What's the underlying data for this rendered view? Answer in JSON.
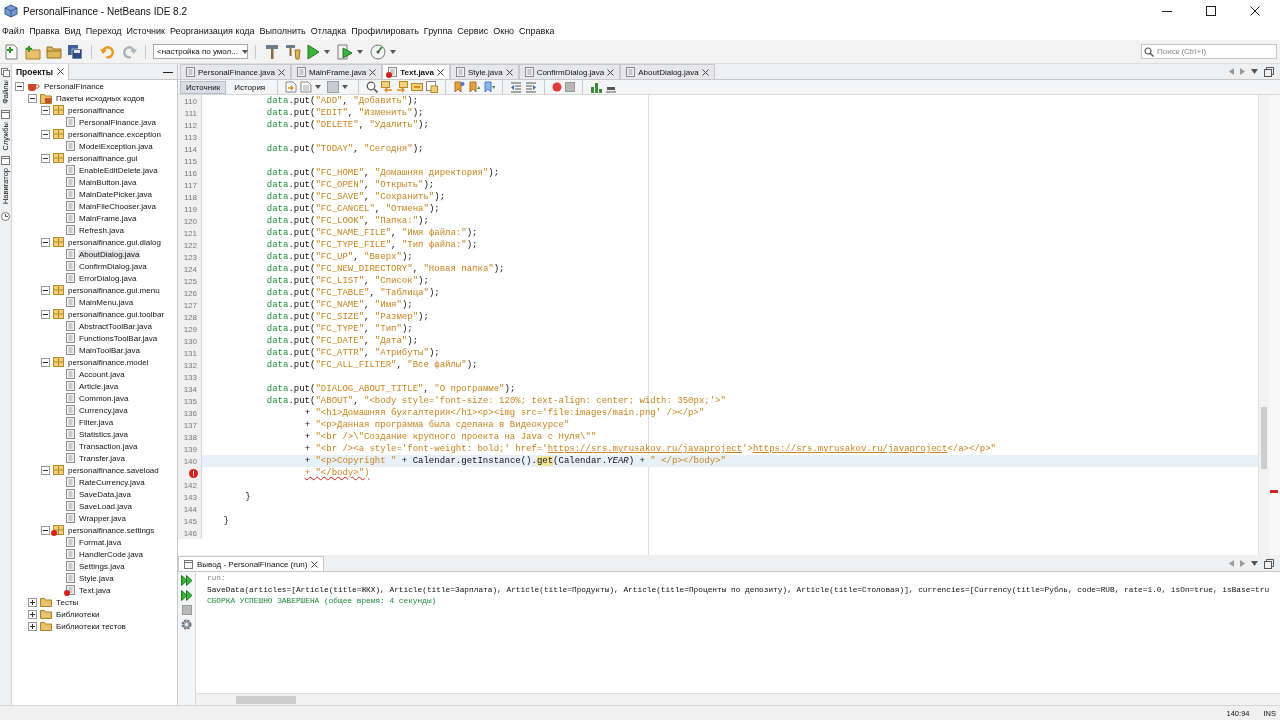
{
  "window": {
    "title": "PersonalFinance - NetBeans IDE 8.2"
  },
  "menu": [
    "Файл",
    "Правка",
    "Вид",
    "Переход",
    "Источник",
    "Реорганизация кода",
    "Выполнить",
    "Отладка",
    "Профилировать",
    "Группа",
    "Сервис",
    "Окно",
    "Справка"
  ],
  "toolbar": {
    "configuration": "<настройка по умол..."
  },
  "search": {
    "placeholder": "Поиск (Ctrl+I)"
  },
  "side_panels": [
    {
      "label": "Файлы"
    },
    {
      "label": "Службы"
    },
    {
      "label": "Навигатор"
    }
  ],
  "projects": {
    "title": "Проекты",
    "tree": [
      {
        "label": "PersonalFinance",
        "kind": "project",
        "expanded": true,
        "selected": false,
        "error": false,
        "children": [
          {
            "label": "Пакеты исходных кодов",
            "kind": "sources",
            "expanded": true,
            "selected": false,
            "error": false,
            "children": [
              {
                "label": "personalfinance",
                "kind": "package",
                "expanded": true,
                "selected": false,
                "error": false,
                "children": [
                  {
                    "label": "PersonalFinance.java",
                    "kind": "file",
                    "selected": false,
                    "error": false
                  }
                ]
              },
              {
                "label": "personalfinance.exception",
                "kind": "package",
                "expanded": true,
                "selected": false,
                "error": false,
                "children": [
                  {
                    "label": "ModelException.java",
                    "kind": "file",
                    "selected": false,
                    "error": false
                  }
                ]
              },
              {
                "label": "personalfinance.gui",
                "kind": "package",
                "expanded": true,
                "selected": false,
                "error": false,
                "children": [
                  {
                    "label": "EnableEditDelete.java",
                    "kind": "file",
                    "selected": false,
                    "error": false
                  },
                  {
                    "label": "MainButton.java",
                    "kind": "file",
                    "selected": false,
                    "error": false
                  },
                  {
                    "label": "MainDatePicker.java",
                    "kind": "file",
                    "selected": false,
                    "error": false
                  },
                  {
                    "label": "MainFileChooser.java",
                    "kind": "file",
                    "selected": false,
                    "error": false
                  },
                  {
                    "label": "MainFrame.java",
                    "kind": "file",
                    "selected": false,
                    "error": false
                  },
                  {
                    "label": "Refresh.java",
                    "kind": "file",
                    "selected": false,
                    "error": false
                  }
                ]
              },
              {
                "label": "personalfinance.gui.dialog",
                "kind": "package",
                "expanded": true,
                "selected": false,
                "error": false,
                "children": [
                  {
                    "label": "AboutDialog.java",
                    "kind": "file",
                    "selected": true,
                    "error": false
                  },
                  {
                    "label": "ConfirmDialog.java",
                    "kind": "file",
                    "selected": false,
                    "error": false
                  },
                  {
                    "label": "ErrorDialog.java",
                    "kind": "file",
                    "selected": false,
                    "error": false
                  }
                ]
              },
              {
                "label": "personalfinance.gui.menu",
                "kind": "package",
                "expanded": true,
                "selected": false,
                "error": false,
                "children": [
                  {
                    "label": "MainMenu.java",
                    "kind": "file",
                    "selected": false,
                    "error": false
                  }
                ]
              },
              {
                "label": "personalfinance.gui.toolbar",
                "kind": "package",
                "expanded": true,
                "selected": false,
                "error": false,
                "children": [
                  {
                    "label": "AbstractToolBar.java",
                    "kind": "file",
                    "selected": false,
                    "error": false
                  },
                  {
                    "label": "FunctionsToolBar.java",
                    "kind": "file",
                    "selected": false,
                    "error": false
                  },
                  {
                    "label": "MainToolBar.java",
                    "kind": "file",
                    "selected": false,
                    "error": false
                  }
                ]
              },
              {
                "label": "personalfinance.model",
                "kind": "package",
                "expanded": true,
                "selected": false,
                "error": false,
                "children": [
                  {
                    "label": "Account.java",
                    "kind": "file",
                    "selected": false,
                    "error": false
                  },
                  {
                    "label": "Article.java",
                    "kind": "file",
                    "selected": false,
                    "error": false
                  },
                  {
                    "label": "Common.java",
                    "kind": "file",
                    "selected": false,
                    "error": false
                  },
                  {
                    "label": "Currency.java",
                    "kind": "file",
                    "selected": false,
                    "error": false
                  },
                  {
                    "label": "Filter.java",
                    "kind": "file",
                    "selected": false,
                    "error": false
                  },
                  {
                    "label": "Statistics.java",
                    "kind": "file",
                    "selected": false,
                    "error": false
                  },
                  {
                    "label": "Transaction.java",
                    "kind": "file",
                    "selected": false,
                    "error": false
                  },
                  {
                    "label": "Transfer.java",
                    "kind": "file",
                    "selected": false,
                    "error": false
                  }
                ]
              },
              {
                "label": "personalfinance.saveload",
                "kind": "package",
                "expanded": true,
                "selected": false,
                "error": false,
                "children": [
                  {
                    "label": "RateCurrency.java",
                    "kind": "file",
                    "selected": false,
                    "error": false
                  },
                  {
                    "label": "SaveData.java",
                    "kind": "file",
                    "selected": false,
                    "error": false
                  },
                  {
                    "label": "SaveLoad.java",
                    "kind": "file",
                    "selected": false,
                    "error": false
                  },
                  {
                    "label": "Wrapper.java",
                    "kind": "file",
                    "selected": false,
                    "error": false
                  }
                ]
              },
              {
                "label": "personalfinance.settings",
                "kind": "package",
                "expanded": true,
                "selected": false,
                "error": true,
                "children": [
                  {
                    "label": "Format.java",
                    "kind": "file",
                    "selected": false,
                    "error": false
                  },
                  {
                    "label": "HandlerCode.java",
                    "kind": "file",
                    "selected": false,
                    "error": false
                  },
                  {
                    "label": "Settings.java",
                    "kind": "file",
                    "selected": false,
                    "error": false
                  },
                  {
                    "label": "Style.java",
                    "kind": "file",
                    "selected": false,
                    "error": false
                  },
                  {
                    "label": "Text.java",
                    "kind": "file",
                    "selected": false,
                    "error": true
                  }
                ]
              }
            ]
          },
          {
            "label": "Тесты",
            "kind": "folder",
            "expanded": false,
            "selected": false,
            "error": false
          },
          {
            "label": "Библиотеки",
            "kind": "folder",
            "expanded": false,
            "selected": false,
            "error": false
          },
          {
            "label": "Библиотеки тестов",
            "kind": "folder",
            "expanded": false,
            "selected": false,
            "error": false
          }
        ]
      }
    ]
  },
  "editor": {
    "tabs": [
      {
        "label": "PersonalFinance.java",
        "selected": false,
        "error": false
      },
      {
        "label": "MainFrame.java",
        "selected": false,
        "error": false
      },
      {
        "label": "Text.java",
        "selected": true,
        "error": true
      },
      {
        "label": "Style.java",
        "selected": false,
        "error": false
      },
      {
        "label": "ConfirmDialog.java",
        "selected": false,
        "error": false
      },
      {
        "label": "AboutDialog.java",
        "selected": false,
        "error": false
      }
    ],
    "views": [
      {
        "label": "Источник",
        "selected": true
      },
      {
        "label": "История",
        "selected": false
      }
    ],
    "lines": [
      {
        "number": "110",
        "current": false,
        "error": false,
        "segments": [
          {
            "kind": "field",
            "text": "            data"
          },
          {
            "kind": "plain",
            "text": ".put("
          },
          {
            "kind": "string",
            "text": "\"ADD\""
          },
          {
            "kind": "plain",
            "text": ", "
          },
          {
            "kind": "string",
            "text": "\"Добавить\""
          },
          {
            "kind": "plain",
            "text": ");"
          }
        ]
      },
      {
        "number": "111",
        "current": false,
        "error": false,
        "segments": [
          {
            "kind": "field",
            "text": "            data"
          },
          {
            "kind": "plain",
            "text": ".put("
          },
          {
            "kind": "string",
            "text": "\"EDIT\""
          },
          {
            "kind": "plain",
            "text": ", "
          },
          {
            "kind": "string",
            "text": "\"Изменить\""
          },
          {
            "kind": "plain",
            "text": ");"
          }
        ]
      },
      {
        "number": "112",
        "current": false,
        "error": false,
        "segments": [
          {
            "kind": "field",
            "text": "            data"
          },
          {
            "kind": "plain",
            "text": ".put("
          },
          {
            "kind": "string",
            "text": "\"DELETE\""
          },
          {
            "kind": "plain",
            "text": ", "
          },
          {
            "kind": "string",
            "text": "\"Удалить\""
          },
          {
            "kind": "plain",
            "text": ");"
          }
        ]
      },
      {
        "number": "113",
        "current": false,
        "error": false
      },
      {
        "number": "114",
        "current": false,
        "error": false,
        "segments": [
          {
            "kind": "field",
            "text": "            data"
          },
          {
            "kind": "plain",
            "text": ".put("
          },
          {
            "kind": "string",
            "text": "\"TODAY\""
          },
          {
            "kind": "plain",
            "text": ", "
          },
          {
            "kind": "string",
            "text": "\"Сегодня\""
          },
          {
            "kind": "plain",
            "text": ");"
          }
        ]
      },
      {
        "number": "115",
        "current": false,
        "error": false
      },
      {
        "number": "116",
        "current": false,
        "error": false,
        "segments": [
          {
            "kind": "field",
            "text": "            data"
          },
          {
            "kind": "plain",
            "text": ".put("
          },
          {
            "kind": "string",
            "text": "\"FC_HOME\""
          },
          {
            "kind": "plain",
            "text": ", "
          },
          {
            "kind": "string",
            "text": "\"Домашняя директория\""
          },
          {
            "kind": "plain",
            "text": ");"
          }
        ]
      },
      {
        "number": "117",
        "current": false,
        "error": false,
        "segments": [
          {
            "kind": "field",
            "text": "            data"
          },
          {
            "kind": "plain",
            "text": ".put("
          },
          {
            "kind": "string",
            "text": "\"FC_OPEN\""
          },
          {
            "kind": "plain",
            "text": ", "
          },
          {
            "kind": "string",
            "text": "\"Открыть\""
          },
          {
            "kind": "plain",
            "text": ");"
          }
        ]
      },
      {
        "number": "118",
        "current": false,
        "error": false,
        "segments": [
          {
            "kind": "field",
            "text": "            data"
          },
          {
            "kind": "plain",
            "text": ".put("
          },
          {
            "kind": "string",
            "text": "\"FC_SAVE\""
          },
          {
            "kind": "plain",
            "text": ", "
          },
          {
            "kind": "string",
            "text": "\"Сохранить\""
          },
          {
            "kind": "plain",
            "text": ");"
          }
        ]
      },
      {
        "number": "119",
        "current": false,
        "error": false,
        "segments": [
          {
            "kind": "field",
            "text": "            data"
          },
          {
            "kind": "plain",
            "text": ".put("
          },
          {
            "kind": "string",
            "text": "\"FC_CANCEL\""
          },
          {
            "kind": "plain",
            "text": ", "
          },
          {
            "kind": "string",
            "text": "\"Отмена\""
          },
          {
            "kind": "plain",
            "text": ");"
          }
        ]
      },
      {
        "number": "120",
        "current": false,
        "error": false,
        "segments": [
          {
            "kind": "field",
            "text": "            data"
          },
          {
            "kind": "plain",
            "text": ".put("
          },
          {
            "kind": "string",
            "text": "\"FC_LOOK\""
          },
          {
            "kind": "plain",
            "text": ", "
          },
          {
            "kind": "string",
            "text": "\"Папка:\""
          },
          {
            "kind": "plain",
            "text": ");"
          }
        ]
      },
      {
        "number": "121",
        "current": false,
        "error": false,
        "segments": [
          {
            "kind": "field",
            "text": "            data"
          },
          {
            "kind": "plain",
            "text": ".put("
          },
          {
            "kind": "string",
            "text": "\"FC_NAME_FILE\""
          },
          {
            "kind": "plain",
            "text": ", "
          },
          {
            "kind": "string",
            "text": "\"Имя файла:\""
          },
          {
            "kind": "plain",
            "text": ");"
          }
        ]
      },
      {
        "number": "122",
        "current": false,
        "error": false,
        "segments": [
          {
            "kind": "field",
            "text": "            data"
          },
          {
            "kind": "plain",
            "text": ".put("
          },
          {
            "kind": "string",
            "text": "\"FC_TYPE_FILE\""
          },
          {
            "kind": "plain",
            "text": ", "
          },
          {
            "kind": "string",
            "text": "\"Тип файла:\""
          },
          {
            "kind": "plain",
            "text": ");"
          }
        ]
      },
      {
        "number": "123",
        "current": false,
        "error": false,
        "segments": [
          {
            "kind": "field",
            "text": "            data"
          },
          {
            "kind": "plain",
            "text": ".put("
          },
          {
            "kind": "string",
            "text": "\"FC_UP\""
          },
          {
            "kind": "plain",
            "text": ", "
          },
          {
            "kind": "string",
            "text": "\"Вверх\""
          },
          {
            "kind": "plain",
            "text": ");"
          }
        ]
      },
      {
        "number": "124",
        "current": false,
        "error": false,
        "segments": [
          {
            "kind": "field",
            "text": "            data"
          },
          {
            "kind": "plain",
            "text": ".put("
          },
          {
            "kind": "string",
            "text": "\"FC_NEW_DIRECTORY\""
          },
          {
            "kind": "plain",
            "text": ", "
          },
          {
            "kind": "string",
            "text": "\"Новая папка\""
          },
          {
            "kind": "plain",
            "text": ");"
          }
        ]
      },
      {
        "number": "125",
        "current": false,
        "error": false,
        "segments": [
          {
            "kind": "field",
            "text": "            data"
          },
          {
            "kind": "plain",
            "text": ".put("
          },
          {
            "kind": "string",
            "text": "\"FC_LIST\""
          },
          {
            "kind": "plain",
            "text": ", "
          },
          {
            "kind": "string",
            "text": "\"Список\""
          },
          {
            "kind": "plain",
            "text": ");"
          }
        ]
      },
      {
        "number": "126",
        "current": false,
        "error": false,
        "segments": [
          {
            "kind": "field",
            "text": "            data"
          },
          {
            "kind": "plain",
            "text": ".put("
          },
          {
            "kind": "string",
            "text": "\"FC_TABLE\""
          },
          {
            "kind": "plain",
            "text": ", "
          },
          {
            "kind": "string",
            "text": "\"Таблица\""
          },
          {
            "kind": "plain",
            "text": ");"
          }
        ]
      },
      {
        "number": "127",
        "current": false,
        "error": false,
        "segments": [
          {
            "kind": "field",
            "text": "            data"
          },
          {
            "kind": "plain",
            "text": ".put("
          },
          {
            "kind": "string",
            "text": "\"FC_NAME\""
          },
          {
            "kind": "plain",
            "text": ", "
          },
          {
            "kind": "string",
            "text": "\"Имя\""
          },
          {
            "kind": "plain",
            "text": ");"
          }
        ]
      },
      {
        "number": "128",
        "current": false,
        "error": false,
        "segments": [
          {
            "kind": "field",
            "text": "            data"
          },
          {
            "kind": "plain",
            "text": ".put("
          },
          {
            "kind": "string",
            "text": "\"FC_SIZE\""
          },
          {
            "kind": "plain",
            "text": ", "
          },
          {
            "kind": "string",
            "text": "\"Размер\""
          },
          {
            "kind": "plain",
            "text": ");"
          }
        ]
      },
      {
        "number": "129",
        "current": false,
        "error": false,
        "segments": [
          {
            "kind": "field",
            "text": "            data"
          },
          {
            "kind": "plain",
            "text": ".put("
          },
          {
            "kind": "string",
            "text": "\"FC_TYPE\""
          },
          {
            "kind": "plain",
            "text": ", "
          },
          {
            "kind": "string",
            "text": "\"Тип\""
          },
          {
            "kind": "plain",
            "text": ");"
          }
        ]
      },
      {
        "number": "130",
        "current": false,
        "error": false,
        "segments": [
          {
            "kind": "field",
            "text": "            data"
          },
          {
            "kind": "plain",
            "text": ".put("
          },
          {
            "kind": "string",
            "text": "\"FC_DATE\""
          },
          {
            "kind": "plain",
            "text": ", "
          },
          {
            "kind": "string",
            "text": "\"Дата\""
          },
          {
            "kind": "plain",
            "text": ");"
          }
        ]
      },
      {
        "number": "131",
        "current": false,
        "error": false,
        "segments": [
          {
            "kind": "field",
            "text": "            data"
          },
          {
            "kind": "plain",
            "text": ".put("
          },
          {
            "kind": "string",
            "text": "\"FC_ATTR\""
          },
          {
            "kind": "plain",
            "text": ", "
          },
          {
            "kind": "string",
            "text": "\"Атрибуты\""
          },
          {
            "kind": "plain",
            "text": ");"
          }
        ]
      },
      {
        "number": "132",
        "current": false,
        "error": false,
        "segments": [
          {
            "kind": "field",
            "text": "            data"
          },
          {
            "kind": "plain",
            "text": ".put("
          },
          {
            "kind": "string",
            "text": "\"FC_ALL_FILTER\""
          },
          {
            "kind": "plain",
            "text": ", "
          },
          {
            "kind": "string",
            "text": "\"Все файлы\""
          },
          {
            "kind": "plain",
            "text": ");"
          }
        ]
      },
      {
        "number": "133",
        "current": false,
        "error": false
      },
      {
        "number": "134",
        "current": false,
        "error": false,
        "segments": [
          {
            "kind": "field",
            "text": "            data"
          },
          {
            "kind": "plain",
            "text": ".put("
          },
          {
            "kind": "string",
            "text": "\"DIALOG_ABOUT_TITLE\""
          },
          {
            "kind": "plain",
            "text": ", "
          },
          {
            "kind": "string",
            "text": "\"О программе\""
          },
          {
            "kind": "plain",
            "text": ");"
          }
        ]
      },
      {
        "number": "135",
        "current": false,
        "error": false,
        "segments": [
          {
            "kind": "field",
            "text": "            data"
          },
          {
            "kind": "plain",
            "text": ".put("
          },
          {
            "kind": "string",
            "text": "\"ABOUT\""
          },
          {
            "kind": "plain",
            "text": ", "
          },
          {
            "kind": "string",
            "text": "\"<body style='font-size: 120%; text-align: center; width: 350px;'>\""
          }
        ]
      },
      {
        "number": "136",
        "current": false,
        "error": false,
        "segments": [
          {
            "kind": "plain",
            "text": "                   + "
          },
          {
            "kind": "string",
            "text": "\"<h1>Домашняя бухгалтерия</h1><p><img src='file:images/main.png' /></p>\""
          }
        ]
      },
      {
        "number": "137",
        "current": false,
        "error": false,
        "segments": [
          {
            "kind": "plain",
            "text": "                   + "
          },
          {
            "kind": "string",
            "text": "\"<p>Данная программа была сделана в Видеокурсе\""
          }
        ]
      },
      {
        "number": "138",
        "current": false,
        "error": false,
        "segments": [
          {
            "kind": "plain",
            "text": "                   + "
          },
          {
            "kind": "string",
            "text": "\"<br />\\\"Создание крупного проекта на Java с Нуля\\\"\""
          }
        ]
      },
      {
        "number": "139",
        "current": false,
        "error": false,
        "segments": [
          {
            "kind": "plain",
            "text": "                   + "
          },
          {
            "kind": "string",
            "text": "\"<br /><a style='font-weight: bold;' href='"
          },
          {
            "kind": "link",
            "text": "https://srs.myrusakov.ru/javaproject"
          },
          {
            "kind": "string",
            "text": "'>"
          },
          {
            "kind": "link",
            "text": "https://srs.myrusakov.ru/javaproject"
          },
          {
            "kind": "string",
            "text": "</a></p>\""
          }
        ]
      },
      {
        "number": "140",
        "current": true,
        "error": false,
        "segments": [
          {
            "kind": "plain",
            "text": "                   + "
          },
          {
            "kind": "string",
            "text": "\"<p>Copyright \""
          },
          {
            "kind": "plain",
            "text": " + Calendar.getInstance()."
          },
          {
            "kind": "match",
            "text": "get"
          },
          {
            "kind": "plain",
            "text": "(Calendar."
          },
          {
            "kind": "static",
            "text": "YEAR"
          },
          {
            "kind": "plain",
            "text": ") + "
          },
          {
            "kind": "string",
            "text": "\" </p></body>\""
          }
        ]
      },
      {
        "current": false,
        "error": true,
        "segments": [
          {
            "kind": "error",
            "text": "                   + \"</body>\")"
          }
        ]
      },
      {
        "number": "142",
        "current": false,
        "error": false
      },
      {
        "number": "143",
        "current": false,
        "error": false,
        "segments": [
          {
            "kind": "plain",
            "text": "        }"
          }
        ]
      },
      {
        "number": "144",
        "current": false,
        "error": false
      },
      {
        "number": "145",
        "current": false,
        "error": false,
        "segments": [
          {
            "kind": "plain",
            "text": "    }"
          }
        ]
      },
      {
        "number": "146",
        "current": false,
        "error": false
      }
    ]
  },
  "output": {
    "title": "Вывод - PersonalFinance (run)",
    "lines": [
      {
        "kind": "info",
        "text": "run:"
      },
      {
        "kind": "plain",
        "text": "SaveData(articles=[Article(title=ЖКХ), Article(title=Зарплата), Article(title=Продукты), Article(title=Проценты по депозиту), Article(title=Столовая)], currencies=[Currency(title=Рубль, code=RUB, rate=1.0, isOn=true, isBase=tru"
      },
      {
        "kind": "success",
        "text": "СБОРКА УСПЕШНО ЗАВЕРШЕНА (общее время: 4 секунды)"
      }
    ]
  },
  "status_bar": {
    "position": "140:94",
    "mode": "INS"
  }
}
